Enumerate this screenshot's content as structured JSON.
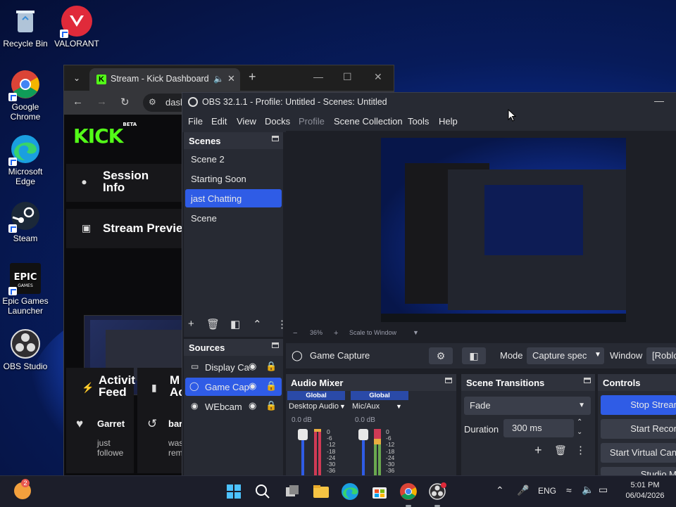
{
  "desktop": {
    "icons": [
      {
        "label": "Recycle Bin"
      },
      {
        "label": "VALORANT"
      },
      {
        "label": "Google Chrome"
      },
      {
        "label": "Microsoft Edge"
      },
      {
        "label": "Steam"
      },
      {
        "label": "Epic Games Launcher"
      },
      {
        "label": "OBS Studio"
      }
    ]
  },
  "browser": {
    "tab_title": "Stream - Kick Dashboard",
    "new_tab": "+",
    "url": "dasl",
    "kick_logo": "KICK",
    "kick_beta": "BETA",
    "session_info": "Session Info",
    "stream_preview": "Stream Previe",
    "activity_feed": "Activit Feed",
    "mod_actions": "M Ac",
    "activity_user": "Garret",
    "activity_text": "just followe",
    "mod_user": "bar",
    "mod_text": "was rem"
  },
  "obs": {
    "title": "OBS 32.1.1 - Profile: Untitled - Scenes: Untitled",
    "menu": [
      "File",
      "Edit",
      "View",
      "Docks",
      "Profile",
      "Scene Collection",
      "Tools",
      "Help"
    ],
    "scenes_title": "Scenes",
    "scenes": [
      "Scene 2",
      "Starting Soon",
      "jast Chatting",
      "Scene"
    ],
    "selected_scene": 2,
    "sources_title": "Sources",
    "sources": [
      "Display Ca",
      "Game Cap",
      "WEbcam"
    ],
    "selected_source": 1,
    "preview_zoom": "36%",
    "preview_zoom_minus": "−",
    "preview_zoom_plus": "+",
    "preview_scale": "Scale to Window",
    "source_name": "Game Capture",
    "mode_label": "Mode",
    "mode_value": "Capture spec",
    "window_label": "Window",
    "window_value": "[Roblo",
    "audio_mixer_title": "Audio Mixer",
    "channels": [
      {
        "header": "Global",
        "name": "Desktop Audio",
        "db": "0.0 dB",
        "level": 0.74
      },
      {
        "header": "Global",
        "name": "Mic/Aux",
        "db": "0.0 dB",
        "level": 0.74
      }
    ],
    "meter_scale": [
      "0",
      "-6",
      "-12",
      "-18",
      "-24",
      "-30",
      "-36"
    ],
    "transitions_title": "Scene Transitions",
    "transition_value": "Fade",
    "duration_label": "Duration",
    "duration_value": "300 ms",
    "controls_title": "Controls",
    "controls": [
      "Stop Strear",
      "Start Recor",
      "Start Virtual Can",
      "Studio M"
    ]
  },
  "taskbar": {
    "notification_badge": "2",
    "language": "ENG",
    "time": "5:01 PM",
    "date": "06/04/2026"
  }
}
